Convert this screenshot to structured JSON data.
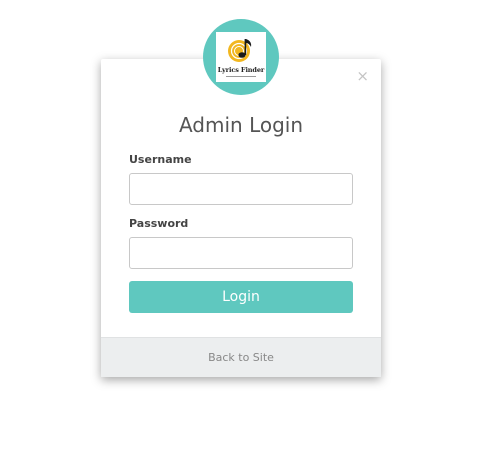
{
  "logo": {
    "icon": "music-note-disc-icon",
    "text": "Lyrics Finder",
    "ring_color": "#5fc8bf",
    "disc_color": "#f2b71f"
  },
  "modal": {
    "close_symbol": "×",
    "title": "Admin Login"
  },
  "form": {
    "username_label": "Username",
    "username_value": "",
    "password_label": "Password",
    "password_value": "",
    "login_label": "Login"
  },
  "footer": {
    "back_link": "Back to Site"
  },
  "colors": {
    "accent": "#5fc8bf",
    "footer_bg": "#eceeef"
  }
}
